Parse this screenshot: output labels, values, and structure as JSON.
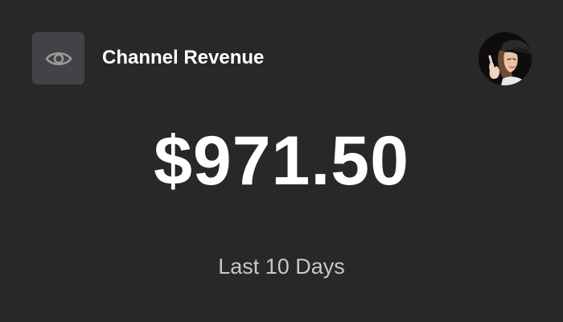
{
  "header": {
    "title": "Channel Revenue",
    "toggle_icon": "eye-icon",
    "avatar_icon": "user-avatar"
  },
  "revenue": {
    "amount": "$971.50",
    "period": "Last 10 Days"
  },
  "colors": {
    "background": "#282828",
    "icon_button_bg": "#434347",
    "icon_color": "#9a9a9a",
    "primary_text": "#ffffff",
    "secondary_text": "#c8c8c8"
  }
}
